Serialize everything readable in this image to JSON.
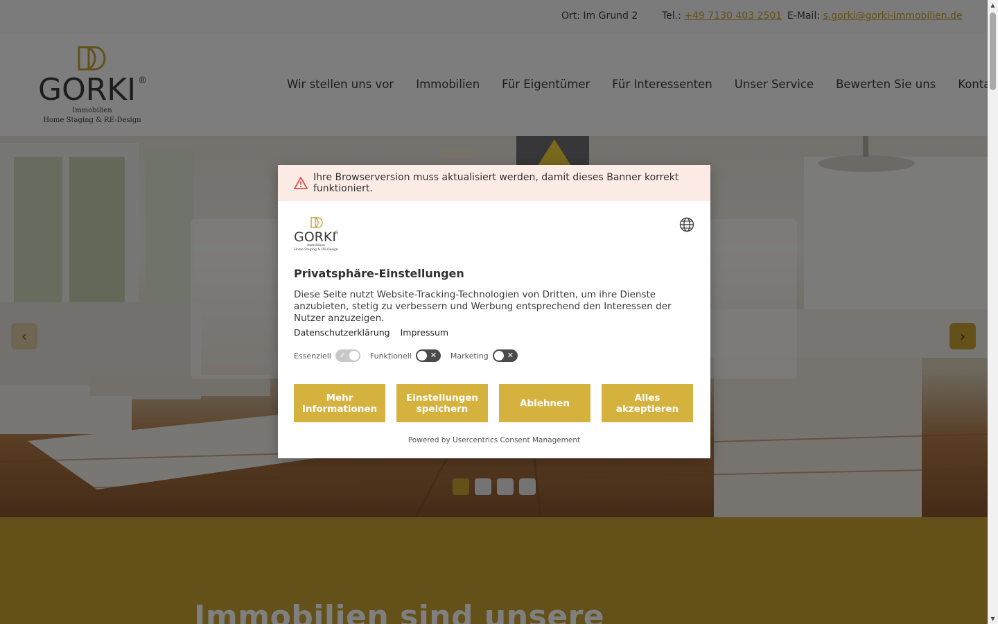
{
  "topbar": {
    "address": "Ort: Im Grund 2",
    "phone_label": "Tel.: ",
    "phone": "+49 7130 403 2501",
    "email_label": "E-Mail: ",
    "email": "s.gorki@gorki-immobilien.de"
  },
  "logo": {
    "brand": "GORKI",
    "registered": "®",
    "line1": "Immobilien",
    "line2": "Home Staging & RE-Design"
  },
  "nav": {
    "items": [
      "Wir stellen uns vor",
      "Immobilien",
      "Für Eigentümer",
      "Für Interessenten",
      "Unser Service",
      "Bewerten Sie uns",
      "Kontakt"
    ]
  },
  "hero": {
    "slide_count": 4,
    "active_slide": 1
  },
  "section": {
    "heading": "Immobilien sind unsere"
  },
  "consent": {
    "warning": "Ihre Browserversion muss aktualisiert werden, damit dieses Banner korrekt funktioniert.",
    "title": "Privatsphäre-Einstellungen",
    "description": "Diese Seite nutzt Website-Tracking-Technologien von Dritten, um ihre Dienste anzubieten, stetig zu verbessern und Werbung entsprechend den Interessen der Nutzer anzuzeigen.",
    "links": {
      "privacy": "Datenschutzerklärung",
      "imprint": "Impressum"
    },
    "toggles": [
      {
        "label": "Essenziell",
        "state": "on",
        "disabled": true
      },
      {
        "label": "Funktionell",
        "state": "off"
      },
      {
        "label": "Marketing",
        "state": "off"
      }
    ],
    "buttons": {
      "more_info": "Mehr Informationen",
      "save_settings": "Einstellungen speichern",
      "deny": "Ablehnen",
      "accept_all": "Alles akzeptieren"
    },
    "powered_by": "Powered by Usercentrics Consent Management"
  },
  "colors": {
    "accent": "#c9a235",
    "button": "#d5b13e",
    "warning_bg": "#fdece6",
    "warning_icon": "#d9534f"
  },
  "icons": {
    "globe": "globe-icon",
    "warning": "warning-triangle-icon",
    "prev": "chevron-left-icon",
    "next": "chevron-right-icon"
  }
}
